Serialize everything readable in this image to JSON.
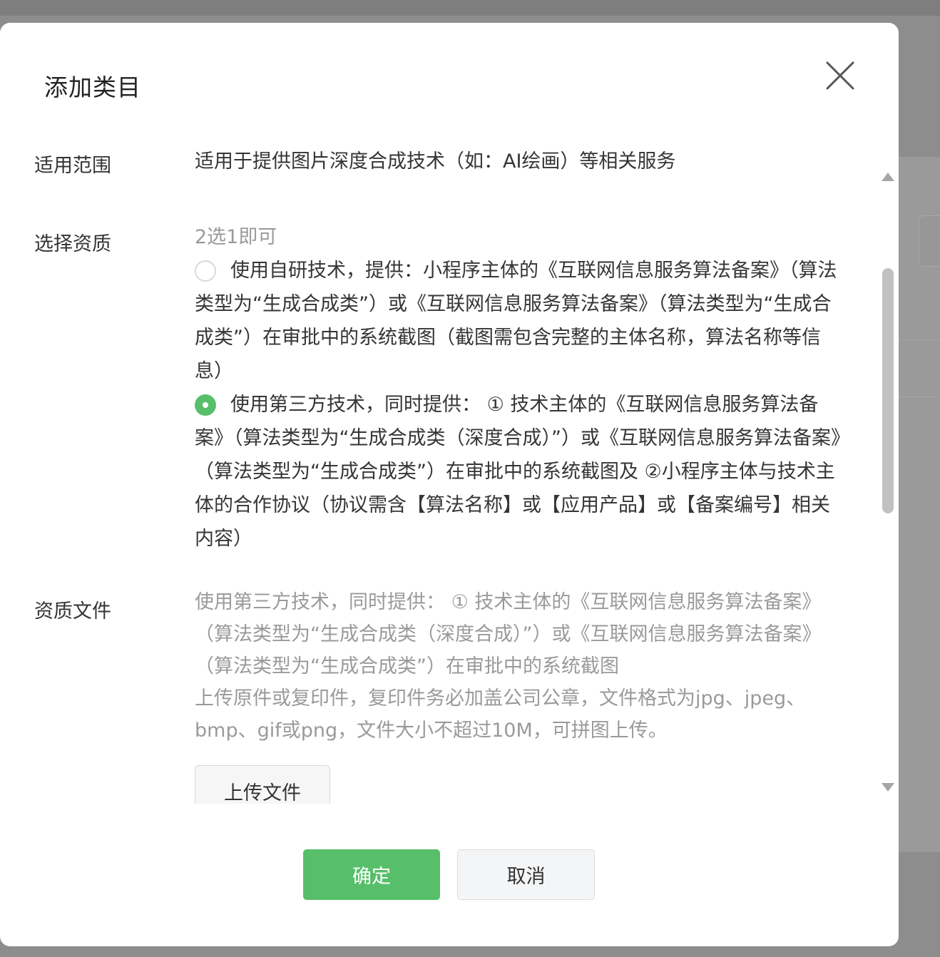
{
  "dialog": {
    "title": "添加类目",
    "close_icon": "close-icon"
  },
  "form": {
    "scope": {
      "label": "适用范围",
      "value": "适用于提供图片深度合成技术（如：AI绘画）等相关服务"
    },
    "qualification": {
      "label": "选择资质",
      "hint": "2选1即可",
      "options": [
        {
          "text": "使用自研技术，提供：小程序主体的《互联网信息服务算法备案》（算法类型为“生成合成类”）或《互联网信息服务算法备案》（算法类型为“生成合成类”）在审批中的系统截图（截图需包含完整的主体名称，算法名称等信息）",
          "selected": false
        },
        {
          "text": "使用第三方技术，同时提供： ① 技术主体的《互联网信息服务算法备案》（算法类型为“生成合成类（深度合成）”）或《互联网信息服务算法备案》（算法类型为“生成合成类”）在审批中的系统截图及 ②小程序主体与技术主体的合作协议（协议需含【算法名称】或【应用产品】或【备案编号】相关内容）",
          "selected": true
        }
      ]
    },
    "files": {
      "label": "资质文件",
      "description": "使用第三方技术，同时提供： ① 技术主体的《互联网信息服务算法备案》（算法类型为“生成合成类（深度合成）”）或《互联网信息服务算法备案》（算法类型为“生成合成类”）在审批中的系统截图",
      "requirements": "上传原件或复印件，复印件务必加盖公司公章，文件格式为jpg、jpeg、bmp、gif或png，文件大小不超过10M，可拼图上传。",
      "upload_label": "上传文件"
    }
  },
  "footer": {
    "confirm_label": "确定",
    "cancel_label": "取消"
  },
  "colors": {
    "accent": "#57bf6a",
    "hint": "#9a9a9a",
    "text": "#353535"
  }
}
